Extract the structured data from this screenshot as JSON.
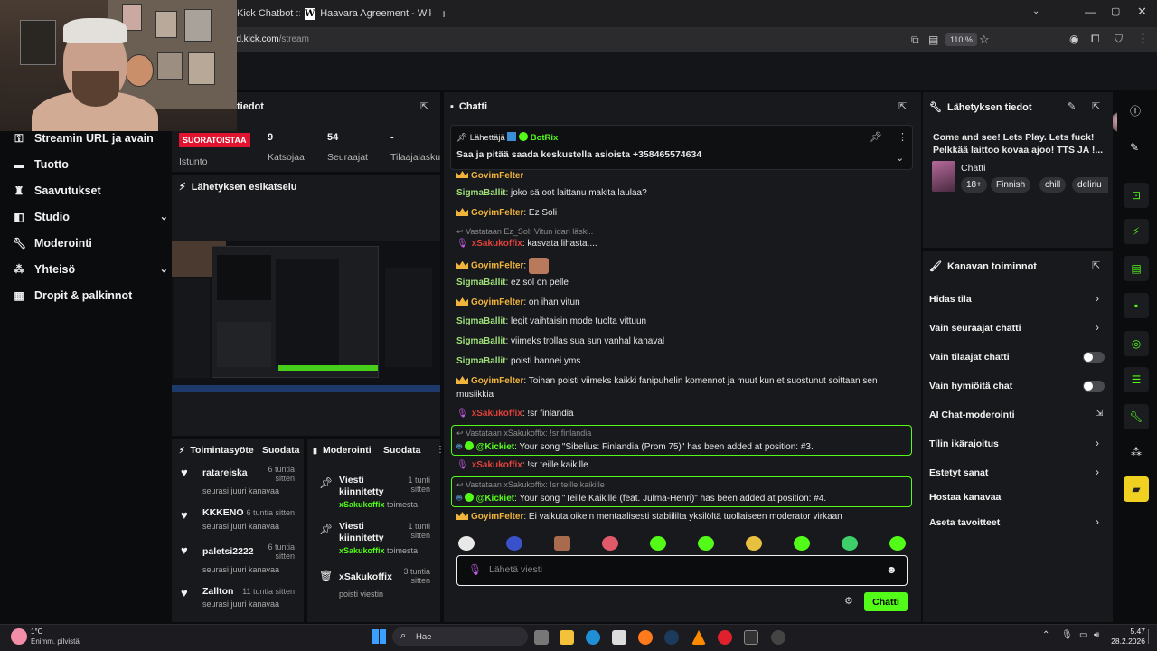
{
  "browser": {
    "tabs": [
      {
        "label": "Kick Chatbot :: ×"
      },
      {
        "label": "Haavara Agreement - Wikipedia"
      }
    ],
    "close_tab_glyph": "×",
    "url_host": "rd.kick.com",
    "url_path": "/stream",
    "zoom": "110 %"
  },
  "leftnav": {
    "items": [
      {
        "label": "Streamin URL ja avain",
        "icon": "key-icon"
      },
      {
        "label": "Tuotto",
        "icon": "wallet-icon"
      },
      {
        "label": "Saavutukset",
        "icon": "trophy-icon"
      },
      {
        "label": "Studio",
        "icon": "studio-icon"
      },
      {
        "label": "Moderointi",
        "icon": "wrench-icon"
      },
      {
        "label": "Yhteisö",
        "icon": "community-icon"
      },
      {
        "label": "Dropit & palkinnot",
        "icon": "gift-icon"
      }
    ]
  },
  "stream_info": {
    "title_partial": "tiedot",
    "live_label": "SUORATOISTAA",
    "session_label": "Istunto",
    "viewers_value": "9",
    "viewers_label": "Katsojaa",
    "followers_value": "54",
    "followers_label": "Seuraajat",
    "subs_value": "-",
    "subs_label": "Tilaajalasku"
  },
  "preview": {
    "title": "Lähetyksen esikatselu"
  },
  "activity": {
    "title": "Toimintasyöte",
    "filter": "Suodata",
    "items": [
      {
        "name": "ratareiska",
        "time": "6 tuntia sitten",
        "sub": "seurasi juuri kanavaa"
      },
      {
        "name": "KKKENO",
        "time": "6 tuntia sitten",
        "sub": "seurasi juuri kanavaa"
      },
      {
        "name": "paletsi2222",
        "time": "6 tuntia sitten",
        "sub": "seurasi juuri kanavaa"
      },
      {
        "name": "Zallton",
        "time": "11 tuntia sitten",
        "sub": "seurasi juuri kanavaa"
      }
    ]
  },
  "moderation": {
    "title": "Moderointi",
    "filter": "Suodata",
    "items": [
      {
        "action": "Viesti kiinnitetty",
        "user": "xSakukoffix",
        "suffix": "toimesta",
        "time": "1 tunti sitten"
      },
      {
        "action": "Viesti kiinnitetty",
        "user": "xSakukoffix",
        "suffix": "toimesta",
        "time": "1 tunti sitten"
      },
      {
        "action": "xSakukoffix",
        "user": "poisti viestin",
        "suffix": "",
        "time": "3 tuntia sitten"
      }
    ]
  },
  "chat": {
    "title": "Chatti",
    "pinned": {
      "sender_label": "Lähettäjä",
      "sender": "BotRix",
      "message": "Saa ja pitää saada keskustella asioista +358465574634"
    },
    "messages": [
      {
        "user": "GoyimFelter",
        "text": "",
        "style": "gold",
        "badge": "crown",
        "partial": true
      },
      {
        "user": "SigmaBallit",
        "text": ": joko sä oot laittanu makita laulaa?",
        "style": "green"
      },
      {
        "user": "GoyimFelter",
        "text": ": Ez Soli",
        "style": "gold",
        "badge": "crown"
      },
      {
        "reply": "Vastataan Ez_Sol: Vitun idari läski..",
        "user": "xSakukoffix",
        "text": ": kasvata lihasta....",
        "style": "red",
        "badge": "mic"
      },
      {
        "user": "GoyimFelter",
        "text": ":",
        "style": "gold",
        "badge": "crown",
        "emote": true
      },
      {
        "user": "SigmaBallit",
        "text": ": ez sol on pelle",
        "style": "green"
      },
      {
        "user": "GoyimFelter",
        "text": ": on ihan vitun",
        "style": "gold",
        "badge": "crown"
      },
      {
        "user": "SigmaBallit",
        "text": ": legit vaihtaisin mode tuolta vittuun",
        "style": "green"
      },
      {
        "user": "SigmaBallit",
        "text": ": viimeks trollas sua sun vanhal kanaval",
        "style": "green"
      },
      {
        "user": "SigmaBallit",
        "text": ": poisti bannei yms",
        "style": "green"
      },
      {
        "user": "GoyimFelter",
        "text": ": Toihan poisti viimeks kaikki fanipuhelin komennot ja muut kun et suostunut soittaan sen",
        "text2": "musiikkia",
        "style": "gold",
        "badge": "crown"
      },
      {
        "user": "xSakukoffix",
        "text": ": !sr finlandia",
        "style": "red",
        "badge": "mic"
      },
      {
        "reply": "Vastataan xSakukoffix: !sr finlandia",
        "user": "@Kickiet",
        "text": ": Your song \"Sibelius: Finlandia (Prom 75)\" has been added at position: #3.",
        "style": "kick",
        "badge": "bot",
        "boxed": true
      },
      {
        "user": "xSakukoffix",
        "text": ": !sr teille kaikille",
        "style": "red",
        "badge": "mic"
      },
      {
        "reply": "Vastataan xSakukoffix: !sr teille kaikille",
        "user": "@Kickiet",
        "text": ": Your song \"Teille Kaikille (feat. Julma-Henri)\" has been added at position: #4.",
        "style": "kick",
        "badge": "bot",
        "boxed": true
      },
      {
        "user": "GoyimFelter",
        "text": ": Ei vaikuta oikein mentaalisesti stabiililta yksilöltä tuollaiseen moderator virkaan",
        "style": "gold",
        "badge": "crown"
      }
    ],
    "input_placeholder": "Lähetä viesti",
    "send_label": "Chatti"
  },
  "broadcast_info": {
    "title": "Lähetyksen tiedot",
    "stream_title": "Come and see! Lets Play. Lets fuck! Pelkkää laittoo kovaa ajoo! TTS JA !...",
    "category": "Chatti",
    "tags": [
      "18+",
      "Finnish",
      "chill",
      "deliriu"
    ]
  },
  "channel_actions": {
    "title": "Kanavan toiminnot",
    "rows": [
      {
        "label": "Hidas tila",
        "control": "chevron"
      },
      {
        "label": "Vain seuraajat chatti",
        "control": "chevron"
      },
      {
        "label": "Vain tilaajat chatti",
        "control": "toggle"
      },
      {
        "label": "Vain hymiöitä chat",
        "control": "toggle"
      },
      {
        "label": "AI Chat-moderointi",
        "control": "external"
      },
      {
        "label": "Tilin ikärajoitus",
        "control": "chevron"
      },
      {
        "label": "Estetyt sanat",
        "control": "chevron"
      },
      {
        "label": "Hostaa kanavaa",
        "control": "none"
      },
      {
        "label": "Aseta tavoitteet",
        "control": "chevron"
      }
    ]
  },
  "taskbar": {
    "weather_temp": "1°C",
    "weather_desc": "Enimm. pilvistä",
    "search_label": "Hae",
    "time": "5.47",
    "date": "28.2.2026"
  },
  "colors": {
    "kick_green": "#53fc18",
    "live_red": "#e2132f",
    "gold_user": "#f0b43c",
    "green_user": "#9fe07a",
    "red_user": "#e0423c"
  }
}
